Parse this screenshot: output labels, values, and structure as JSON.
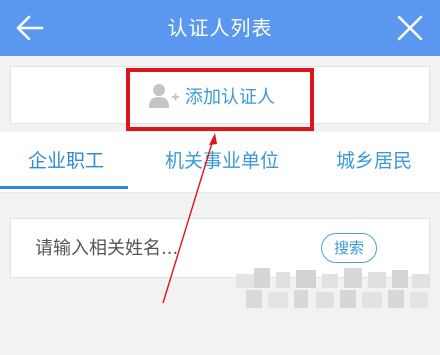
{
  "header": {
    "title": "认证人列表",
    "back_icon": "arrow-left-icon",
    "close_icon": "close-icon",
    "background_color": "#5a98f0"
  },
  "add_certifier": {
    "label": "添加认证人",
    "icon": "add-person-icon",
    "label_color": "#3a9ad9",
    "highlight_color": "#e0151c"
  },
  "tabs": [
    {
      "label": "企业职工",
      "active": true
    },
    {
      "label": "机关事业单位",
      "active": false
    },
    {
      "label": "城乡居民",
      "active": false
    }
  ],
  "search": {
    "placeholder": "请输入相关姓名...",
    "value": "",
    "button_label": "搜索"
  },
  "annotation": {
    "arrow_color": "#e0151c"
  }
}
